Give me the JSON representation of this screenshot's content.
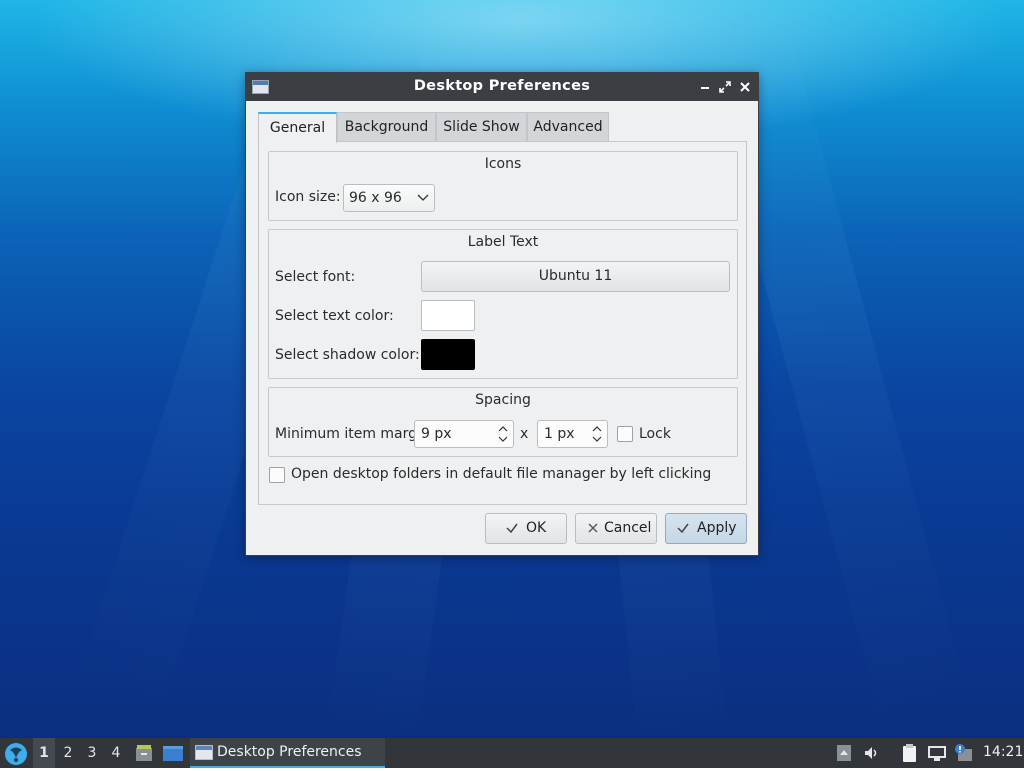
{
  "window": {
    "title": "Desktop Preferences",
    "controls": {
      "minimize": "–",
      "maximize": "⤢",
      "close": "✕"
    }
  },
  "tabs": [
    {
      "label": "General",
      "active": true
    },
    {
      "label": "Background",
      "active": false
    },
    {
      "label": "Slide Show",
      "active": false
    },
    {
      "label": "Advanced",
      "active": false
    }
  ],
  "icons_group": {
    "title": "Icons",
    "icon_size_label": "Icon size:",
    "icon_size_value": "96 x 96"
  },
  "label_text_group": {
    "title": "Label Text",
    "select_font_label": "Select font:",
    "font_value": "Ubuntu 11",
    "text_color_label": "Select text color:",
    "text_color": "#ffffff",
    "shadow_color_label": "Select shadow color:",
    "shadow_color": "#000000"
  },
  "spacing_group": {
    "title": "Spacing",
    "margins_label": "Minimum item margins:",
    "margin_x": "9 px",
    "separator": "x",
    "margin_y": "1 px",
    "lock_label": "Lock",
    "lock_checked": false
  },
  "open_folders": {
    "label": "Open desktop folders in default file manager by left clicking",
    "checked": false
  },
  "buttons": {
    "ok": "OK",
    "cancel": "Cancel",
    "apply": "Apply"
  },
  "taskbar": {
    "desktops": [
      "1",
      "2",
      "3",
      "4"
    ],
    "active_desktop": "1",
    "task_title": "Desktop Preferences",
    "clock": "14:21"
  },
  "colors": {
    "accent": "#3daee9",
    "titlebar": "#3b3f44",
    "taskbar": "#32363b",
    "window_bg": "#eff0f1"
  }
}
